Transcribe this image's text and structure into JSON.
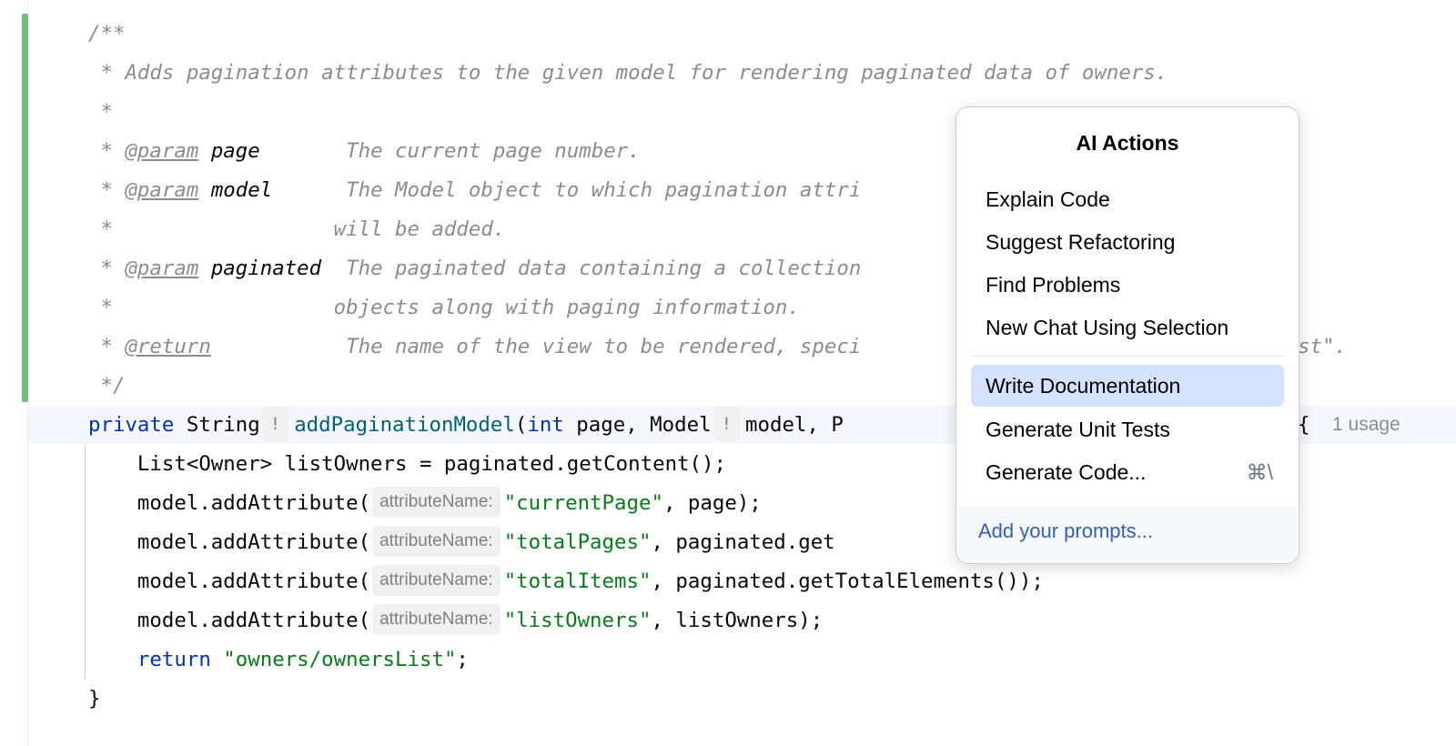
{
  "code": {
    "l0": "/**",
    "l1": " * Adds pagination attributes to the given model for rendering paginated data of owners.",
    "l2": " *",
    "l3": {
      "pre": " * ",
      "tag": "@param",
      "name": " page      ",
      "desc": " The current page number."
    },
    "l4": {
      "pre": " * ",
      "tag": "@param",
      "name": " model     ",
      "desc": " The Model object to which pagination attri"
    },
    "l5": " *                  will be added.",
    "l6": {
      "pre": " * ",
      "tag": "@param",
      "name": " paginated ",
      "desc": " The paginated data containing a collection"
    },
    "l7": " *                  objects along with paging information.",
    "l8": {
      "pre": " * ",
      "tag": "@return",
      "desc": "           The name of the view to be rendered, speci",
      "tail": "st\"."
    },
    "l9": " */",
    "sig": {
      "kw1": "private",
      "type1": " String",
      "bang": "!",
      "fn": "addPaginationModel",
      "p1": "(",
      "kw2": "int",
      "p2": " page, Model",
      "p3": "model, P",
      "brace": "{"
    },
    "l11": "    List<Owner> listOwners = paginated.getContent();",
    "attr_prefix": "    model.addAttribute(",
    "hint": "attributeName:",
    "a1": {
      "str": "\"currentPage\"",
      "rest": ", page);"
    },
    "a2": {
      "str": "\"totalPages\"",
      "rest": ", paginated.get"
    },
    "a3": {
      "str": "\"totalItems\"",
      "rest": ", paginated.getTotalElements());"
    },
    "a4": {
      "str": "\"listOwners\"",
      "rest": ", listOwners);"
    },
    "ret": {
      "kw": "    return",
      "str": " \"owners/ownersList\"",
      "end": ";"
    },
    "close": "}",
    "usage": "1 usage"
  },
  "popup": {
    "title": "AI Actions",
    "items": [
      "Explain Code",
      "Suggest Refactoring",
      "Find Problems",
      "New Chat Using Selection",
      "Write Documentation",
      "Generate Unit Tests",
      "Generate Code..."
    ],
    "shortcut": "⌘\\",
    "footer": "Add your prompts..."
  }
}
